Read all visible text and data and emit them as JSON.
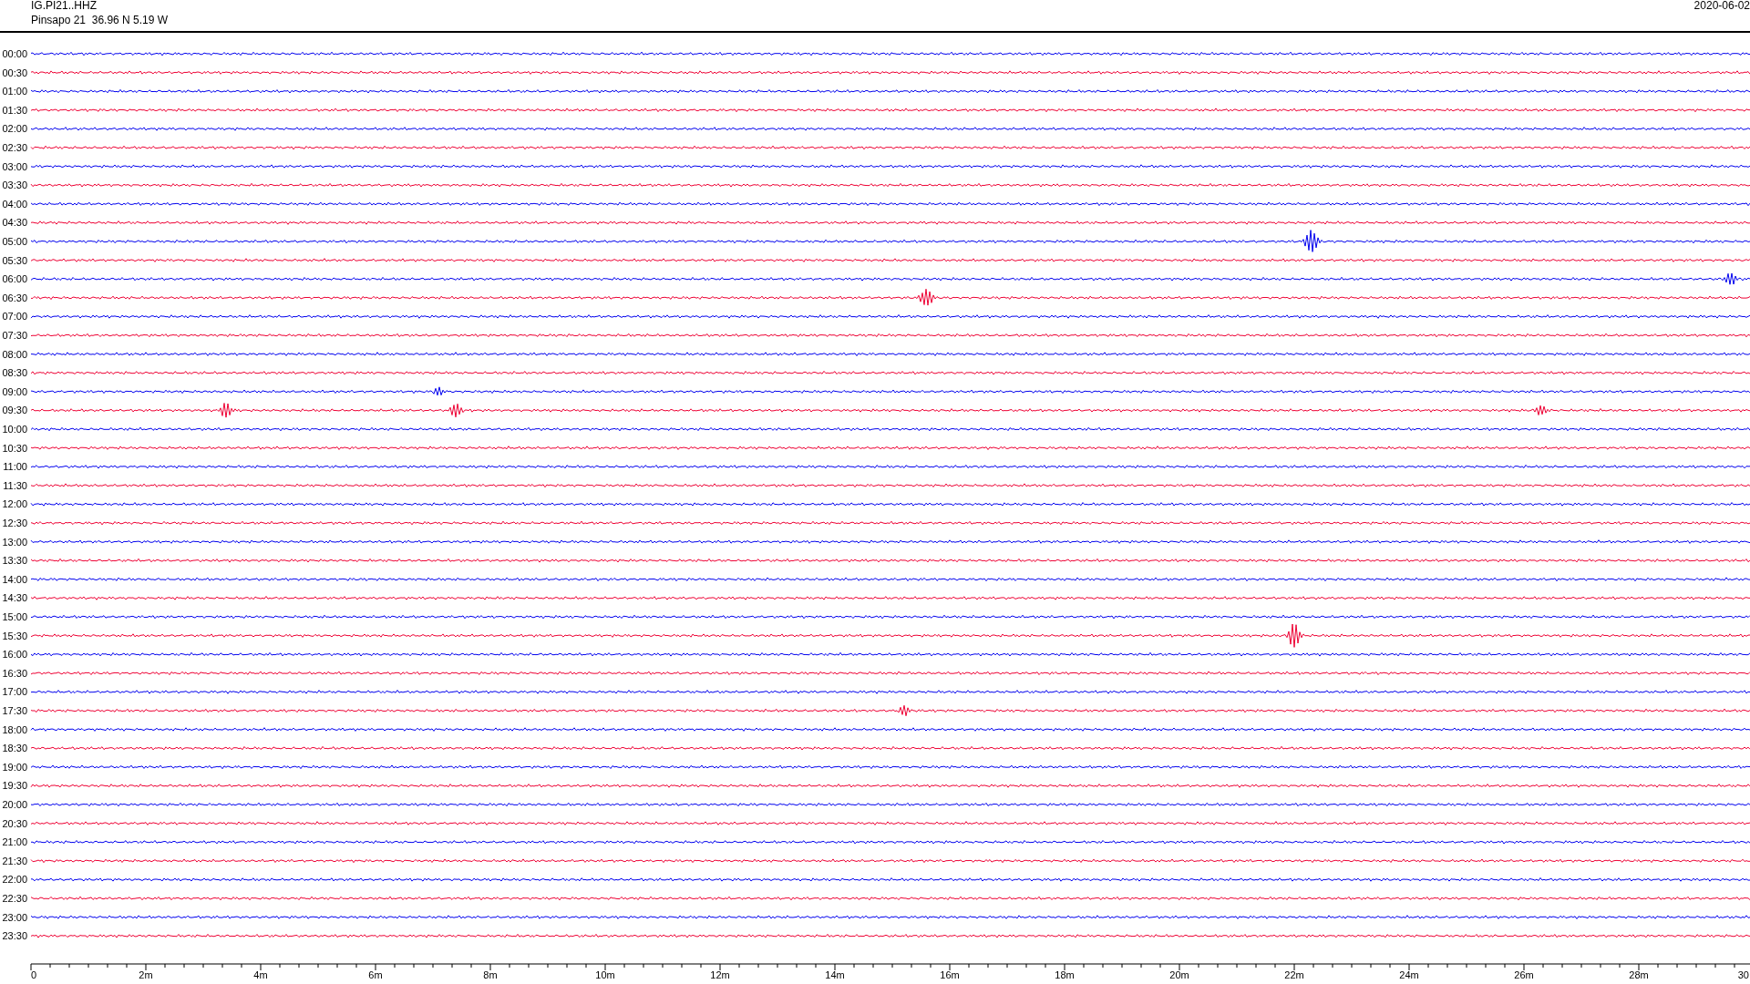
{
  "header": {
    "channel": "IG.PI21..HHZ",
    "station": "Pinsapo 21  36.96 N 5.19 W",
    "date": "2020-06-02"
  },
  "traces": [
    {
      "time": "00:00",
      "color": "#0000ee"
    },
    {
      "time": "00:30",
      "color": "#ee0033"
    },
    {
      "time": "01:00",
      "color": "#0000ee"
    },
    {
      "time": "01:30",
      "color": "#ee0033"
    },
    {
      "time": "02:00",
      "color": "#0000ee"
    },
    {
      "time": "02:30",
      "color": "#ee0033"
    },
    {
      "time": "03:00",
      "color": "#0000ee"
    },
    {
      "time": "03:30",
      "color": "#ee0033"
    },
    {
      "time": "04:00",
      "color": "#0000ee"
    },
    {
      "time": "04:30",
      "color": "#ee0033"
    },
    {
      "time": "05:00",
      "color": "#0000ee"
    },
    {
      "time": "05:30",
      "color": "#ee0033"
    },
    {
      "time": "06:00",
      "color": "#0000ee"
    },
    {
      "time": "06:30",
      "color": "#ee0033"
    },
    {
      "time": "07:00",
      "color": "#0000ee"
    },
    {
      "time": "07:30",
      "color": "#ee0033"
    },
    {
      "time": "08:00",
      "color": "#0000ee"
    },
    {
      "time": "08:30",
      "color": "#ee0033"
    },
    {
      "time": "09:00",
      "color": "#0000ee"
    },
    {
      "time": "09:30",
      "color": "#ee0033"
    },
    {
      "time": "10:00",
      "color": "#0000ee"
    },
    {
      "time": "10:30",
      "color": "#ee0033"
    },
    {
      "time": "11:00",
      "color": "#0000ee"
    },
    {
      "time": "11:30",
      "color": "#ee0033"
    },
    {
      "time": "12:00",
      "color": "#0000ee"
    },
    {
      "time": "12:30",
      "color": "#ee0033"
    },
    {
      "time": "13:00",
      "color": "#0000ee"
    },
    {
      "time": "13:30",
      "color": "#ee0033"
    },
    {
      "time": "14:00",
      "color": "#0000ee"
    },
    {
      "time": "14:30",
      "color": "#ee0033"
    },
    {
      "time": "15:00",
      "color": "#0000ee"
    },
    {
      "time": "15:30",
      "color": "#ee0033"
    },
    {
      "time": "16:00",
      "color": "#0000ee"
    },
    {
      "time": "16:30",
      "color": "#ee0033"
    },
    {
      "time": "17:00",
      "color": "#0000ee"
    },
    {
      "time": "17:30",
      "color": "#ee0033"
    },
    {
      "time": "18:00",
      "color": "#0000ee"
    },
    {
      "time": "18:30",
      "color": "#ee0033"
    },
    {
      "time": "19:00",
      "color": "#0000ee"
    },
    {
      "time": "19:30",
      "color": "#ee0033"
    },
    {
      "time": "20:00",
      "color": "#0000ee"
    },
    {
      "time": "20:30",
      "color": "#ee0033"
    },
    {
      "time": "21:00",
      "color": "#0000ee"
    },
    {
      "time": "21:30",
      "color": "#ee0033"
    },
    {
      "time": "22:00",
      "color": "#0000ee"
    },
    {
      "time": "22:30",
      "color": "#ee0033"
    },
    {
      "time": "23:00",
      "color": "#0000ee"
    },
    {
      "time": "23:30",
      "color": "#ee0033"
    }
  ],
  "axis": {
    "labels": [
      "0",
      "2m",
      "4m",
      "6m",
      "8m",
      "10m",
      "12m",
      "14m",
      "16m",
      "18m",
      "20m",
      "22m",
      "24m",
      "26m",
      "28m",
      "30"
    ]
  }
}
